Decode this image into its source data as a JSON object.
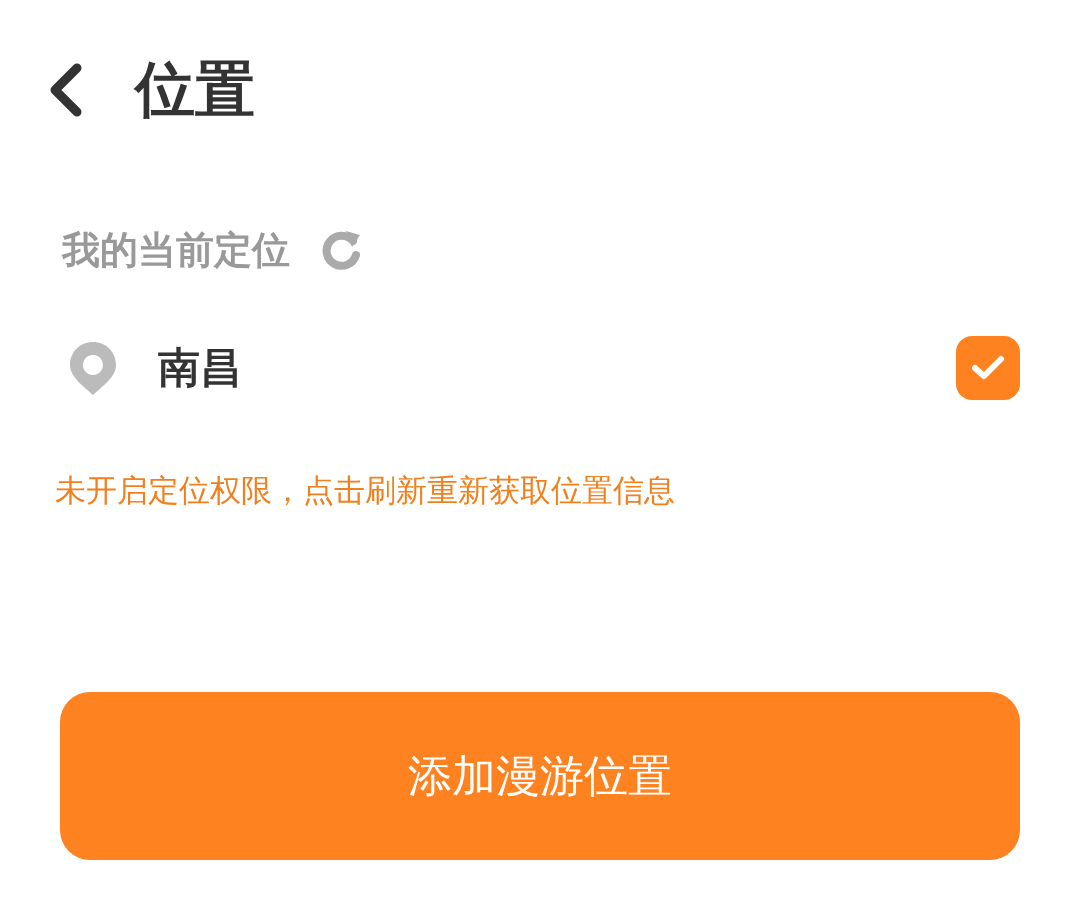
{
  "header": {
    "title": "位置"
  },
  "current_location": {
    "label": "我的当前定位",
    "city": "南昌",
    "selected": true
  },
  "notice": "未开启定位权限，点击刷新重新获取位置信息",
  "add_button": "添加漫游位置"
}
